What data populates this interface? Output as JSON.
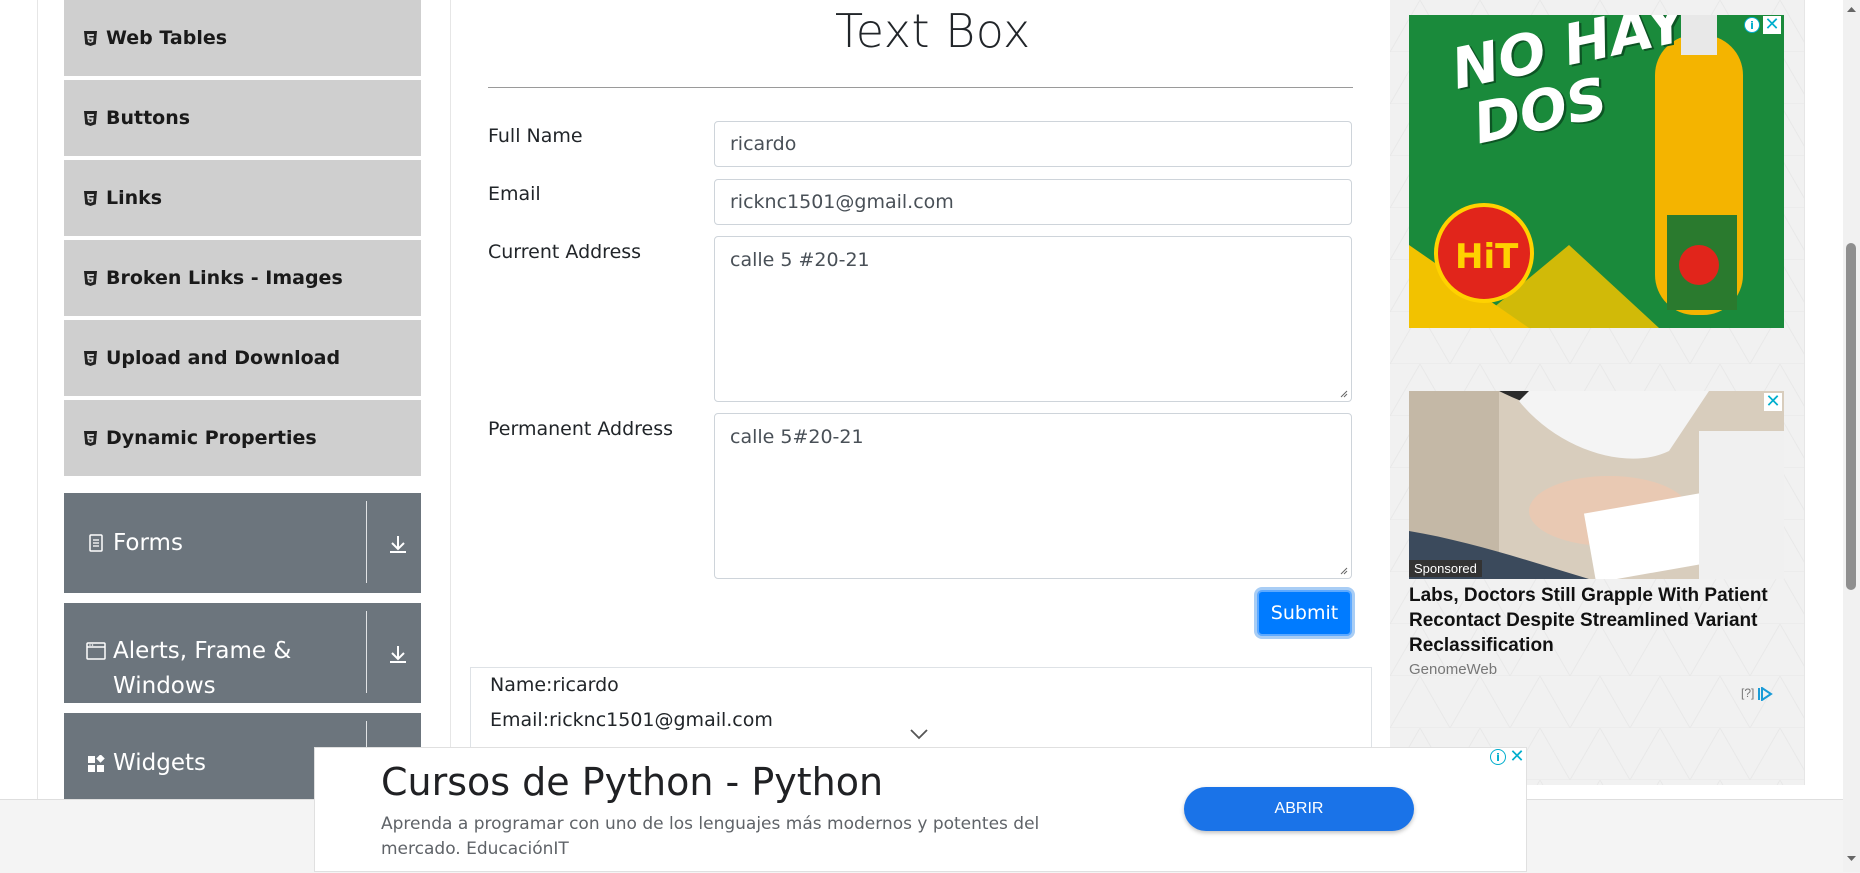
{
  "sidebar": {
    "items": [
      {
        "label": "Web Tables",
        "icon": "html5-icon"
      },
      {
        "label": "Buttons",
        "icon": "html5-icon"
      },
      {
        "label": "Links",
        "icon": "html5-icon"
      },
      {
        "label": "Broken Links - Images",
        "icon": "html5-icon"
      },
      {
        "label": "Upload and Download",
        "icon": "html5-icon"
      },
      {
        "label": "Dynamic Properties",
        "icon": "html5-icon"
      }
    ],
    "groups": [
      {
        "label": "Forms",
        "icon": "document-icon"
      },
      {
        "label_line1": "Alerts, Frame &",
        "label_line2": "Windows",
        "icon": "browser-window-icon"
      },
      {
        "label": "Widgets",
        "icon": "widgets-grid-icon"
      }
    ]
  },
  "main": {
    "title": "Text Box",
    "form": {
      "full_name_label": "Full Name",
      "full_name_value": "ricardo",
      "email_label": "Email",
      "email_value": "ricknc1501@gmail.com",
      "current_address_label": "Current Address",
      "current_address_value": "calle 5 #20-21",
      "permanent_address_label": "Permanent Address",
      "permanent_address_value": "calle 5#20-21",
      "submit_label": "Submit"
    },
    "output": {
      "name_line": "Name:ricardo",
      "email_line": "Email:ricknc1501@gmail.com"
    }
  },
  "ads": {
    "ad1": {
      "slogan_line1": "NO HAY",
      "slogan_line2": "DOS",
      "brand": "HiT"
    },
    "ad2": {
      "sponsored": "Sponsored",
      "headline": "Labs, Doctors Still Grapple With Patient Recontact Despite Streamlined Variant Reclassification",
      "source": "GenomeWeb",
      "help": "[?]"
    }
  },
  "banner": {
    "title": "Cursos de Python - Python",
    "description": "Aprenda a programar con uno de los lenguajes más modernos y potentes del mercado. EducaciónIT",
    "cta": "ABRIR"
  },
  "colors": {
    "sidebar_item_bg": "#cfcfcf",
    "sidebar_group_bg": "#6c757d",
    "primary": "#007bff",
    "ad_accent": "#00aecd"
  }
}
